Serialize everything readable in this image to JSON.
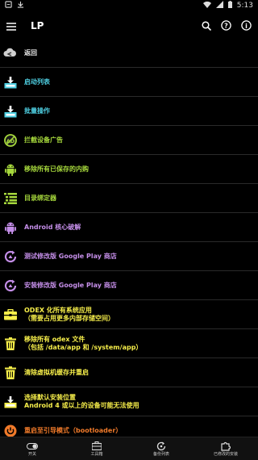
{
  "status_bar": {
    "time": "5:13"
  },
  "app_bar": {
    "title": "LP"
  },
  "menu": [
    {
      "name": "back",
      "icon": "cloud-back-icon",
      "line1": "返回",
      "line2": "",
      "color": "#e8e8e8"
    },
    {
      "name": "launch-list",
      "icon": "download-tray-icon",
      "line1": "启动列表",
      "line2": "",
      "color": "#4fd0e3"
    },
    {
      "name": "batch-ops",
      "icon": "download-tray-icon",
      "line1": "批量操作",
      "line2": "",
      "color": "#4fd0e3"
    },
    {
      "name": "block-ads",
      "icon": "ad-block-icon",
      "line1": "拦截设备广告",
      "line2": "",
      "color": "#a6d83c"
    },
    {
      "name": "remove-saved",
      "icon": "android-icon",
      "line1": "移除所有已保存的内购",
      "line2": "",
      "color": "#a6d83c"
    },
    {
      "name": "dir-binder",
      "icon": "list-icon",
      "line1": "目录绑定器",
      "line2": "",
      "color": "#a6d83c"
    },
    {
      "name": "core-patch",
      "icon": "android-icon",
      "line1": "Android 核心破解",
      "line2": "",
      "color": "#c48ee8"
    },
    {
      "name": "test-gplay",
      "icon": "refresh-icon",
      "line1": "测试修改版 Google Play 商店",
      "line2": "",
      "color": "#c48ee8"
    },
    {
      "name": "install-gplay",
      "icon": "refresh-icon",
      "line1": "安装修改版 Google Play 商店",
      "line2": "",
      "color": "#c48ee8"
    },
    {
      "name": "odex-system",
      "icon": "briefcase-icon",
      "line1": "ODEX 化所有系统应用",
      "line2": "（需要占用更多内部存储空间）",
      "color": "#f6ee4a"
    },
    {
      "name": "remove-odex",
      "icon": "trash-icon",
      "line1": "移除所有 odex 文件",
      "line2": "（包括 /data/app 和 /system/app）",
      "color": "#f6ee4a"
    },
    {
      "name": "clear-dalvik",
      "icon": "trash-icon",
      "line1": "清除虚拟机缓存并重启",
      "line2": "",
      "color": "#f6ee4a"
    },
    {
      "name": "install-location",
      "icon": "download-tray-icon",
      "line1": "选择默认安装位置",
      "line2": "Android 4 或以上的设备可能无法使用",
      "color": "#f6ee4a"
    },
    {
      "name": "reboot-bootloader",
      "icon": "power-icon",
      "line1": "重启至引导模式（bootloader）",
      "line2": "",
      "color": "#f07a2a"
    }
  ],
  "bottom_nav": [
    {
      "name": "switches",
      "icon": "toggle-icon",
      "label": "开关"
    },
    {
      "name": "toolbox",
      "icon": "toolbox-icon",
      "label": "工具箱"
    },
    {
      "name": "backups",
      "icon": "backup-icon",
      "label": "备份列表"
    },
    {
      "name": "patched-apps",
      "icon": "puzzle-icon",
      "label": "已修改的安装"
    }
  ]
}
